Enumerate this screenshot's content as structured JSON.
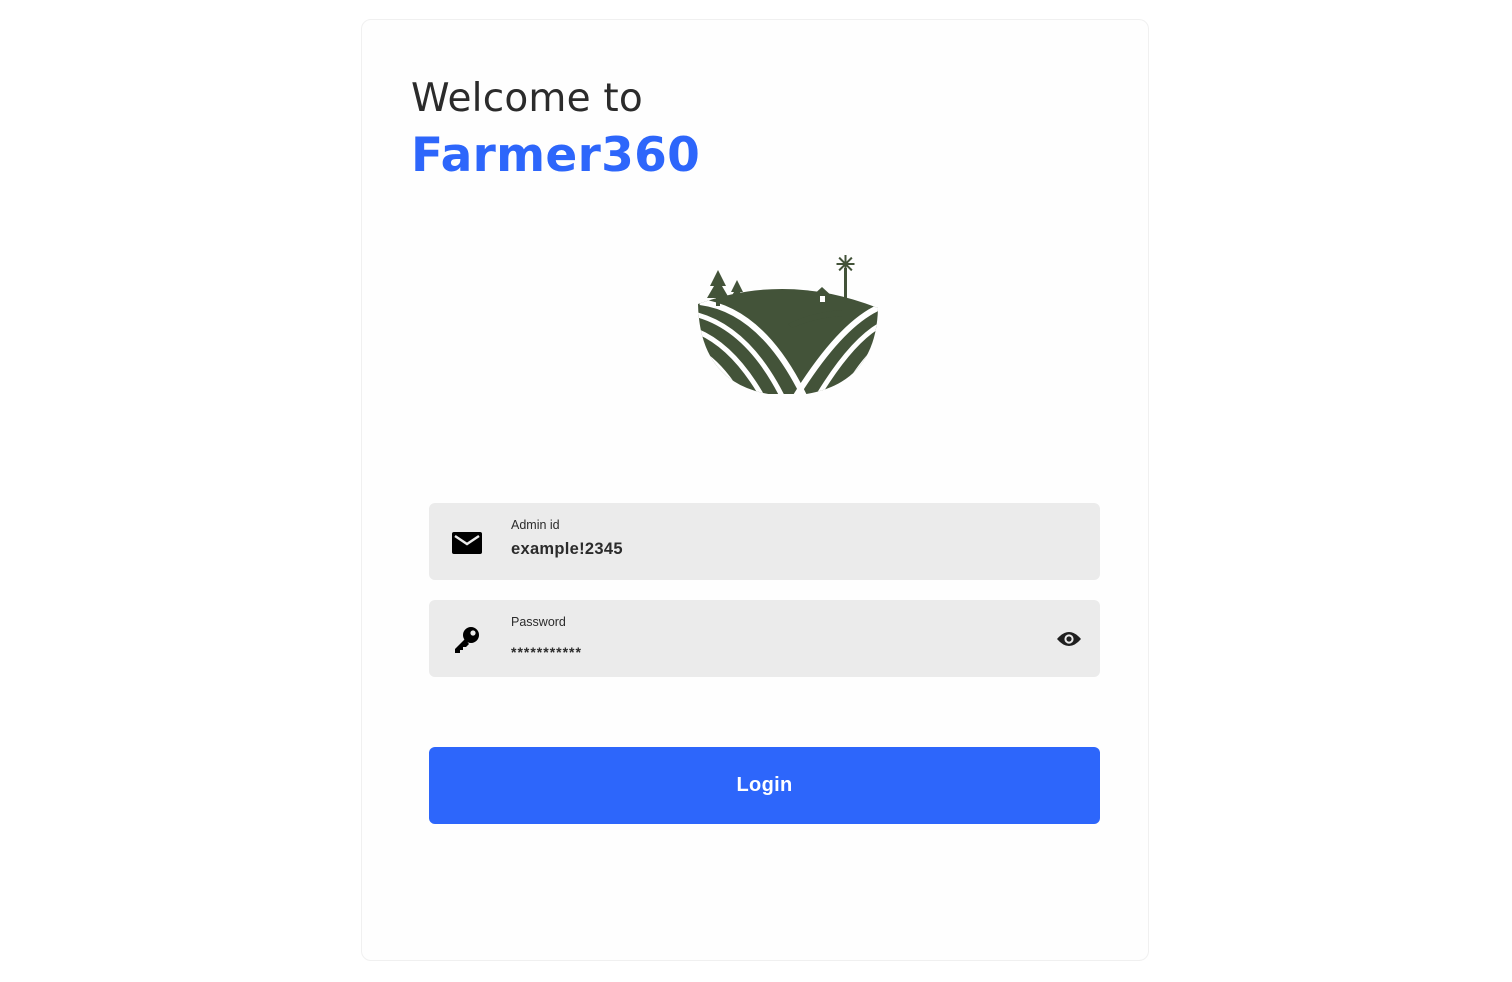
{
  "header": {
    "welcome": "Welcome to",
    "brand": "Farmer360"
  },
  "logo": {
    "icon": "farm-logo-icon",
    "color": "#435339"
  },
  "form": {
    "admin": {
      "label": "Admin id",
      "value": "example!2345",
      "icon": "mail-icon"
    },
    "password": {
      "label": "Password",
      "value": "***********",
      "icon": "key-icon",
      "toggle_icon": "eye-icon"
    },
    "login_label": "Login"
  },
  "colors": {
    "accent": "#2d66fb",
    "field_bg": "#ebebeb",
    "logo": "#435339"
  }
}
